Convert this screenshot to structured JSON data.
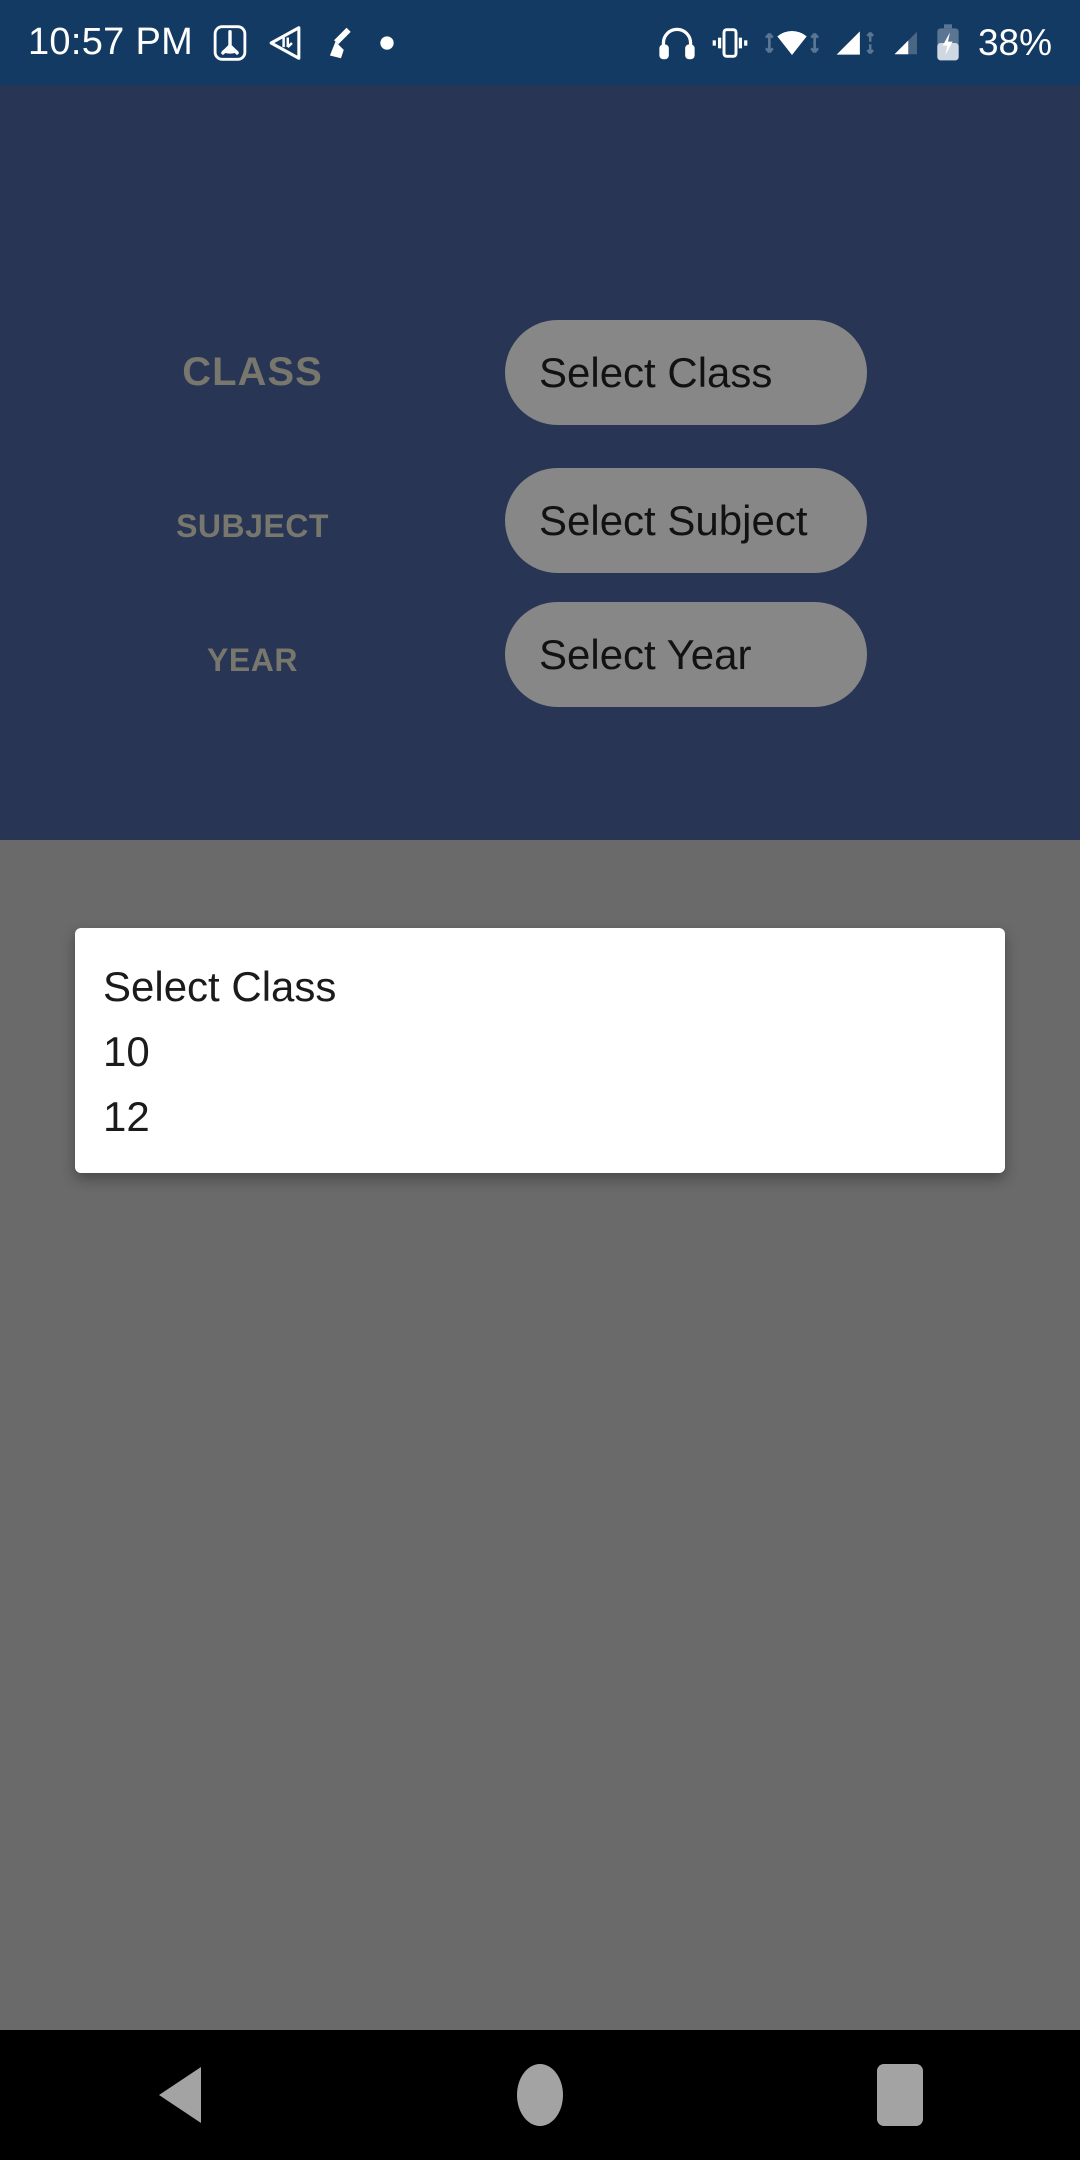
{
  "status_bar": {
    "time": "10:57 PM",
    "battery_percent": "38%",
    "left_icons": [
      "app-notification-icon",
      "volume-back-icon",
      "broom-cleaner-icon",
      "dot-notification-icon"
    ],
    "right_icons": [
      "headphones-icon",
      "vibrate-icon",
      "wifi-icon",
      "signal-sim1-icon",
      "signal-sim2-icon",
      "battery-charging-icon"
    ],
    "background_color": "#133a62",
    "foreground_color": "#ffffff"
  },
  "form": {
    "background_color": "#293554",
    "label_color": "#77776d",
    "button_color": "#878787",
    "button_text_color": "#121212",
    "rows": [
      {
        "label": "CLASS",
        "button_label": "Select Class"
      },
      {
        "label": "SUBJECT",
        "button_label": "Select Subject"
      },
      {
        "label": "YEAR",
        "button_label": "Select Year"
      }
    ]
  },
  "scrim": {
    "color": "#6a6a6a"
  },
  "dialog": {
    "title": "Select Class",
    "background_color": "#ffffff",
    "text_color": "#1b1b1b",
    "options": [
      "10",
      "12"
    ]
  },
  "nav_bar": {
    "background_color": "#000000",
    "icon_color": "#a3a3a3",
    "buttons": [
      "back-button",
      "home-button",
      "recents-button"
    ]
  }
}
